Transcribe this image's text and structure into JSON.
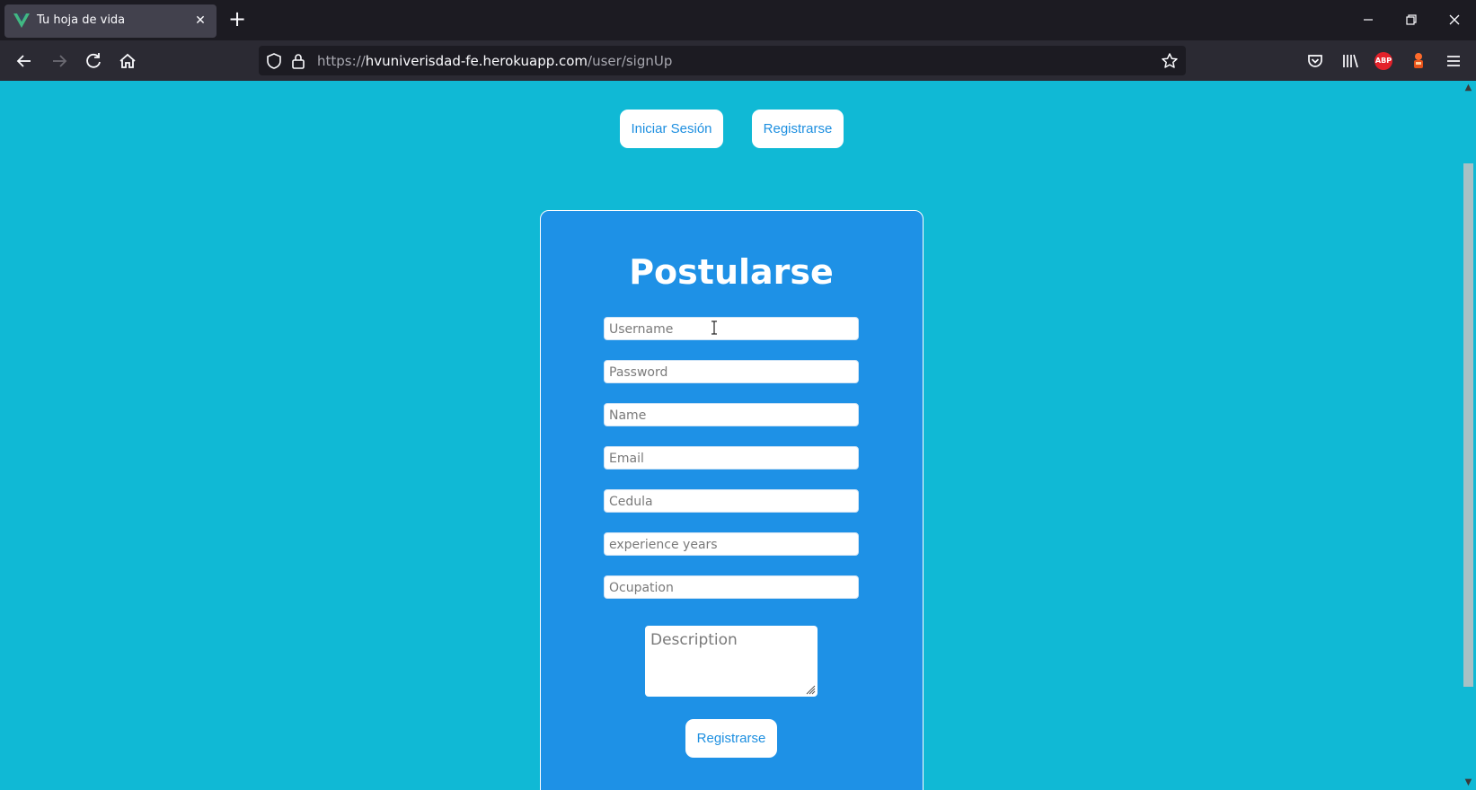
{
  "browser": {
    "tab_title": "Tu hoja de vida",
    "url_prefix": "https://",
    "url_host": "hvuniverisdad-fe.herokuapp.com",
    "url_path": "/user/signUp",
    "abp_label": "ABP",
    "icons": [
      "vue-logo-icon",
      "close-icon",
      "plus-icon",
      "minimize-icon",
      "restore-icon",
      "window-close-icon",
      "back-icon",
      "forward-icon",
      "reload-icon",
      "home-icon",
      "shield-icon",
      "lock-icon",
      "star-icon",
      "pocket-icon",
      "library-icon",
      "adblock-icon",
      "extension-icon",
      "menu-icon"
    ]
  },
  "page": {
    "nav": {
      "login_label": "Iniciar Sesión",
      "register_label": "Registrarse"
    },
    "form": {
      "title": "Postularse",
      "fields": {
        "username": "Username",
        "password": "Password",
        "name": "Name",
        "email": "Email",
        "cedula": "Cedula",
        "experience": "experience years",
        "ocupation": "Ocupation",
        "description": "Description"
      },
      "submit_label": "Registrarse"
    }
  },
  "colors": {
    "page_background": "#10b9d5",
    "card_background": "#1e91e6",
    "button_text": "#1d8fe0"
  }
}
